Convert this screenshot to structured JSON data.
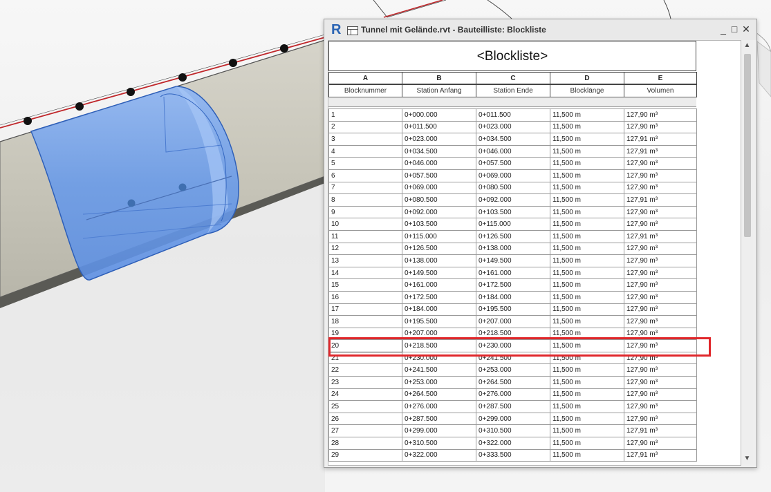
{
  "window": {
    "app_icon": "R",
    "title": "Tunnel mit Gelände.rvt - Bauteilliste: Blockliste",
    "min_glyph": "_",
    "max_glyph": "□",
    "close_glyph": "✕"
  },
  "schedule": {
    "title": "<Blockliste>",
    "column_letters": [
      "A",
      "B",
      "C",
      "D",
      "E"
    ],
    "headers": [
      "Blocknummer",
      "Station Anfang",
      "Station Ende",
      "Blocklänge",
      "Volumen"
    ],
    "rows": [
      [
        "1",
        "0+000.000",
        "0+011.500",
        "11,500 m",
        "127,90 m³"
      ],
      [
        "2",
        "0+011.500",
        "0+023.000",
        "11,500 m",
        "127,90 m³"
      ],
      [
        "3",
        "0+023.000",
        "0+034.500",
        "11,500 m",
        "127,91 m³"
      ],
      [
        "4",
        "0+034.500",
        "0+046.000",
        "11,500 m",
        "127,91 m³"
      ],
      [
        "5",
        "0+046.000",
        "0+057.500",
        "11,500 m",
        "127,90 m³"
      ],
      [
        "6",
        "0+057.500",
        "0+069.000",
        "11,500 m",
        "127,90 m³"
      ],
      [
        "7",
        "0+069.000",
        "0+080.500",
        "11,500 m",
        "127,90 m³"
      ],
      [
        "8",
        "0+080.500",
        "0+092.000",
        "11,500 m",
        "127,91 m³"
      ],
      [
        "9",
        "0+092.000",
        "0+103.500",
        "11,500 m",
        "127,90 m³"
      ],
      [
        "10",
        "0+103.500",
        "0+115.000",
        "11,500 m",
        "127,90 m³"
      ],
      [
        "11",
        "0+115.000",
        "0+126.500",
        "11,500 m",
        "127,91 m³"
      ],
      [
        "12",
        "0+126.500",
        "0+138.000",
        "11,500 m",
        "127,90 m³"
      ],
      [
        "13",
        "0+138.000",
        "0+149.500",
        "11,500 m",
        "127,90 m³"
      ],
      [
        "14",
        "0+149.500",
        "0+161.000",
        "11,500 m",
        "127,90 m³"
      ],
      [
        "15",
        "0+161.000",
        "0+172.500",
        "11,500 m",
        "127,90 m³"
      ],
      [
        "16",
        "0+172.500",
        "0+184.000",
        "11,500 m",
        "127,90 m³"
      ],
      [
        "17",
        "0+184.000",
        "0+195.500",
        "11,500 m",
        "127,90 m³"
      ],
      [
        "18",
        "0+195.500",
        "0+207.000",
        "11,500 m",
        "127,90 m³"
      ],
      [
        "19",
        "0+207.000",
        "0+218.500",
        "11,500 m",
        "127,90 m³"
      ],
      [
        "20",
        "0+218.500",
        "0+230.000",
        "11,500 m",
        "127,90 m³"
      ],
      [
        "21",
        "0+230.000",
        "0+241.500",
        "11,500 m",
        "127,90 m³"
      ],
      [
        "22",
        "0+241.500",
        "0+253.000",
        "11,500 m",
        "127,90 m³"
      ],
      [
        "23",
        "0+253.000",
        "0+264.500",
        "11,500 m",
        "127,90 m³"
      ],
      [
        "24",
        "0+264.500",
        "0+276.000",
        "11,500 m",
        "127,90 m³"
      ],
      [
        "25",
        "0+276.000",
        "0+287.500",
        "11,500 m",
        "127,90 m³"
      ],
      [
        "26",
        "0+287.500",
        "0+299.000",
        "11,500 m",
        "127,90 m³"
      ],
      [
        "27",
        "0+299.000",
        "0+310.500",
        "11,500 m",
        "127,91 m³"
      ],
      [
        "28",
        "0+310.500",
        "0+322.000",
        "11,500 m",
        "127,90 m³"
      ],
      [
        "29",
        "0+322.000",
        "0+333.500",
        "11,500 m",
        "127,91 m³"
      ]
    ]
  },
  "scrollbar": {
    "up_glyph": "▲",
    "down_glyph": "▼"
  },
  "colors": {
    "selection_block": "#7aa7ef",
    "highlight_frame": "#e0262a",
    "alignment_line": "#c0262a",
    "tunnel_shell": "#c9c7bc"
  }
}
